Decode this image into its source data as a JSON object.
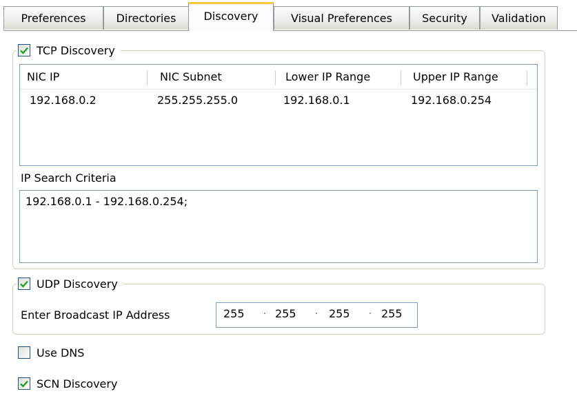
{
  "tabs": [
    {
      "label": "Preferences"
    },
    {
      "label": "Directories"
    },
    {
      "label": "Discovery"
    },
    {
      "label": "Visual Preferences"
    },
    {
      "label": "Security"
    },
    {
      "label": "Validation"
    }
  ],
  "active_tab": "Discovery",
  "tcp": {
    "label": "TCP Discovery",
    "checked": true,
    "columns": [
      "NIC IP",
      "NIC Subnet",
      "Lower IP Range",
      "Upper IP Range"
    ],
    "rows": [
      [
        "192.168.0.2",
        "255.255.255.0",
        "192.168.0.1",
        "192.168.0.254"
      ]
    ],
    "criteria_label": "IP Search Criteria",
    "criteria_value": "192.168.0.1 - 192.168.0.254;"
  },
  "udp": {
    "label": "UDP Discovery",
    "checked": true,
    "broadcast_label": "Enter Broadcast IP Address",
    "octets": [
      "255",
      "255",
      "255",
      "255"
    ]
  },
  "dns": {
    "label": "Use DNS",
    "checked": false
  },
  "scn": {
    "label": "SCN Discovery",
    "checked": true
  },
  "colors": {
    "check": "#21a121",
    "border": "#7f9db9",
    "tab_highlight": "#ffc83c"
  }
}
